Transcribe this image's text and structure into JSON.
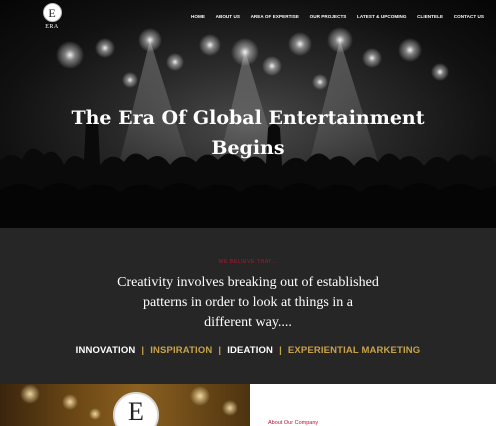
{
  "brand": {
    "logo_letter": "E",
    "logo_text": "ERA"
  },
  "nav": {
    "items": [
      {
        "label": "HOME"
      },
      {
        "label": "ABOUT US"
      },
      {
        "label": "AREA OF EXPERTISE"
      },
      {
        "label": "OUR PROJECTS"
      },
      {
        "label": "LATEST & UPCOMING"
      },
      {
        "label": "CLIENTELE"
      },
      {
        "label": "CONTACT US"
      }
    ]
  },
  "hero": {
    "title_line1": "The Era Of Global Entertainment",
    "title_line2": "Begins"
  },
  "believe": {
    "kicker": "WE BELIEVE THAT...",
    "quote_line1": "Creativity involves breaking out of established",
    "quote_line2": "patterns in order to look at things in a",
    "quote_line3": "different way....",
    "pillars": [
      {
        "label": "INNOVATION",
        "color": "#ffffff"
      },
      {
        "label": "INSPIRATION",
        "color": "#c9a24b"
      },
      {
        "label": "IDEATION",
        "color": "#ffffff"
      },
      {
        "label": "EXPERIENTIAL MARKETING",
        "color": "#c9a24b"
      }
    ],
    "separator": "|"
  },
  "about": {
    "emblem_letter": "E",
    "link_label": "About Our Company"
  },
  "colors": {
    "accent_red": "#b9142c",
    "accent_gold": "#c9a24b",
    "section_bg": "#262626"
  }
}
